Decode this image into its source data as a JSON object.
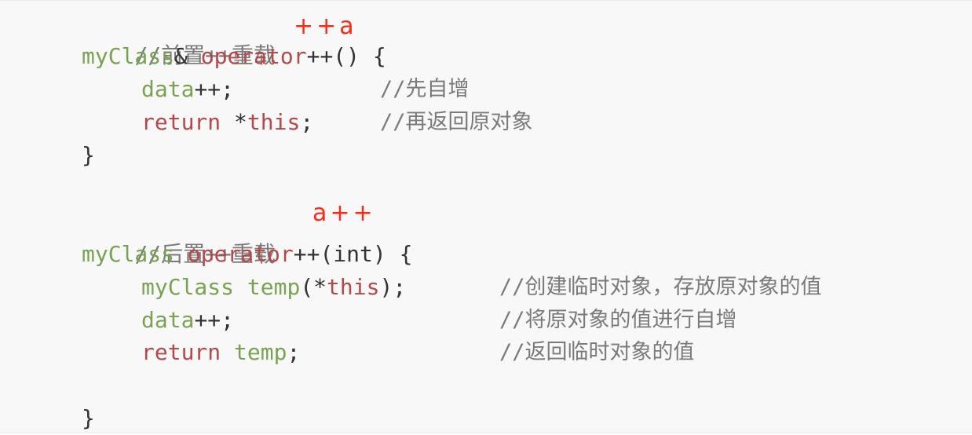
{
  "code": {
    "prefix_comment": "//前置++重载",
    "prefix_note": "++a",
    "prefix_sig_type": "myClass",
    "prefix_sig_amp": "& ",
    "prefix_sig_op": "operator",
    "prefix_sig_rest": "++() {",
    "prefix_l1_id": "data",
    "prefix_l1_rest": "++;",
    "prefix_l1_comment": "//先自增",
    "prefix_l2_kw": "return",
    "prefix_l2_star": " *",
    "prefix_l2_this": "this",
    "prefix_l2_rest": ";",
    "prefix_l2_comment": "//再返回原对象",
    "prefix_close": "}",
    "postfix_comment": "//后置++重载",
    "postfix_note": "a++",
    "postfix_sig_type": "myClass",
    "postfix_sig_op": "operator",
    "postfix_sig_mid": "++(",
    "postfix_sig_int": "int",
    "postfix_sig_end": ") {",
    "postfix_l1_type": "myClass",
    "postfix_l1_fn": "temp",
    "postfix_l1_open": "(*",
    "postfix_l1_this": "this",
    "postfix_l1_end": ");",
    "postfix_l1_comment": "//创建临时对象，存放原对象的值",
    "postfix_l2_id": "data",
    "postfix_l2_rest": "++;",
    "postfix_l2_comment": "//将原对象的值进行自增",
    "postfix_l3_kw": "return",
    "postfix_l3_id": "temp",
    "postfix_l3_rest": ";",
    "postfix_l3_comment": "//返回临时对象的值",
    "postfix_close": "}"
  },
  "colors": {
    "comment": "#7a7a7a",
    "type": "#7aa253",
    "keyword": "#b4484a",
    "annotation": "#ff2a14",
    "background": "#f8f8f8"
  }
}
